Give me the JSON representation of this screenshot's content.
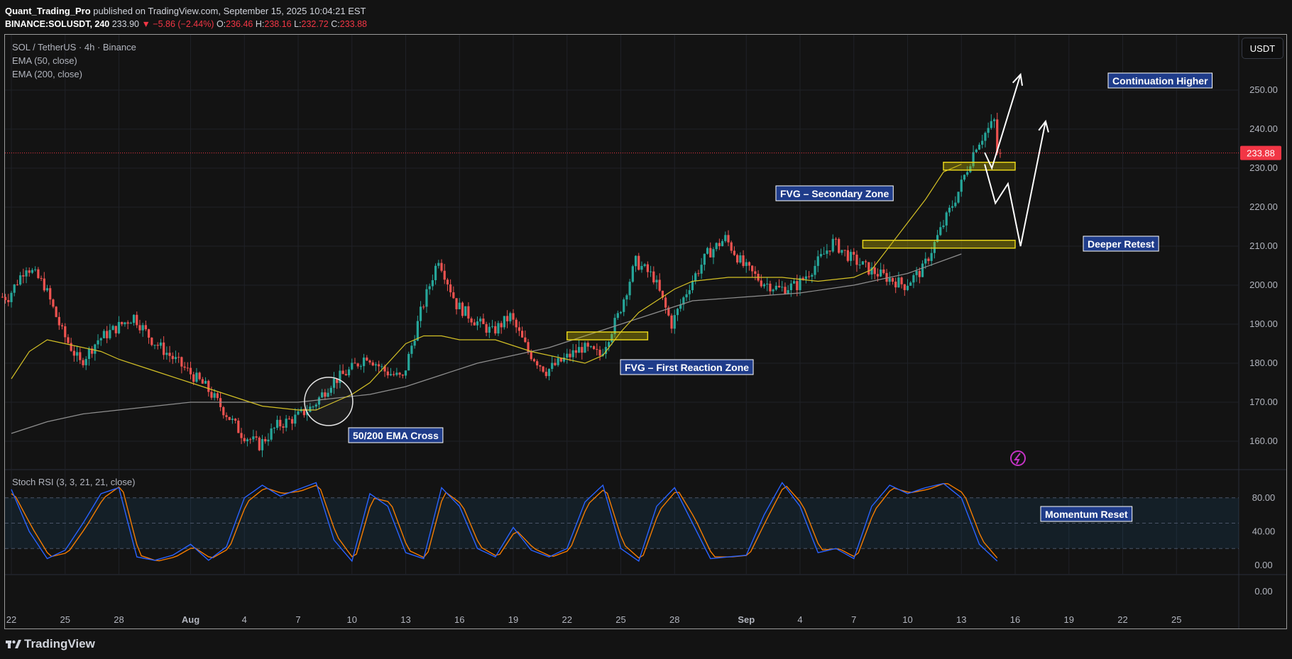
{
  "header": {
    "author": "Quant_Trading_Pro",
    "published_text": "published on TradingView.com, September 15, 2025 10:04:21 EST",
    "symbol_line": "BINANCE:SOLUSDT, 240",
    "price": "233.90",
    "change": "▼ −5.86 (−2.44%)",
    "open_label": "O:",
    "open": "236.46",
    "high_label": "H:",
    "high": "238.16",
    "low_label": "L:",
    "low": "232.72",
    "close_label": "C:",
    "close": "233.88"
  },
  "legend": {
    "title": "SOL / TetherUS · 4h · Binance",
    "ema50": "EMA (50, close)",
    "ema200": "EMA (200, close)",
    "stoch": "Stoch RSI (3, 3, 21, 21, close)"
  },
  "currency_button": "USDT",
  "last_price_tag": "233.88",
  "branding": "TradingView",
  "colors": {
    "up": "#26a69a",
    "down": "#ef5350",
    "ema50": "#d4c126",
    "ema200": "#8f8f8f",
    "stoch_k": "#2962ff",
    "stoch_d": "#f57c00",
    "zone": "#c8b800",
    "annotation": "#1f3c8a"
  },
  "chart_data": [
    {
      "type": "candlestick",
      "title": "SOL / TetherUS · 4h · Binance",
      "ylim": [
        155,
        257
      ],
      "y_ticks": [
        160,
        170,
        180,
        190,
        200,
        210,
        220,
        230,
        240,
        250
      ],
      "y_tick_labels": [
        "160.00",
        "170.00",
        "180.00",
        "190.00",
        "200.00",
        "210.00",
        "220.00",
        "230.00",
        "240.00",
        "250.00"
      ],
      "x_tick_labels": [
        "22",
        "25",
        "28",
        "Aug",
        "4",
        "7",
        "10",
        "13",
        "16",
        "19",
        "22",
        "25",
        "28",
        "Sep",
        "4",
        "7",
        "10",
        "13",
        "16",
        "19",
        "22",
        "25"
      ],
      "x_tick_days": [
        -10,
        -7,
        -4,
        0,
        3,
        6,
        9,
        12,
        15,
        18,
        21,
        24,
        27,
        31,
        34,
        37,
        40,
        43,
        46,
        49,
        52,
        55
      ],
      "x_label_note": "day index relative to Aug 1, 2025",
      "ohlc_key_closes": {
        "days": [
          -10,
          -9,
          -8,
          -7,
          -6,
          -5,
          -4,
          -3,
          -2,
          -1,
          0,
          1,
          2,
          3,
          4,
          5,
          6,
          7,
          8,
          9,
          10,
          11,
          12,
          13,
          14,
          15,
          16,
          17,
          18,
          19,
          20,
          21,
          22,
          23,
          24,
          25,
          26,
          27,
          28,
          29,
          30,
          31,
          32,
          33,
          34,
          35,
          36,
          37,
          38,
          39,
          40,
          41,
          42,
          43,
          44,
          45
        ],
        "close": [
          197,
          205,
          200,
          188,
          180,
          186,
          189,
          192,
          186,
          182,
          178,
          174,
          168,
          162,
          159,
          164,
          166,
          169,
          175,
          178,
          182,
          178,
          176,
          193,
          207,
          195,
          191,
          188,
          192,
          183,
          178,
          181,
          184,
          182,
          192,
          206,
          202,
          190,
          200,
          208,
          212,
          205,
          201,
          199,
          200,
          205,
          211,
          207,
          204,
          202,
          200,
          204,
          214,
          224,
          236,
          242,
          238,
          234
        ]
      },
      "last_price": 233.88,
      "ema50_close": [
        176,
        183,
        186,
        185,
        184,
        183,
        181,
        178,
        175,
        172,
        169,
        168,
        168,
        170,
        172,
        175,
        180,
        185,
        187,
        187,
        186,
        186,
        183,
        181,
        180,
        182,
        188,
        193,
        196,
        199,
        201,
        202,
        202,
        202,
        201,
        202,
        204,
        210,
        216,
        222,
        229,
        231
      ],
      "ema50_days": [
        -10,
        -9,
        -8,
        -7,
        -6,
        -5,
        -4,
        -2,
        0,
        2,
        4,
        6,
        7,
        8,
        9,
        10,
        11,
        12,
        13,
        14,
        15,
        17,
        19,
        21,
        22,
        23,
        24,
        25,
        26,
        27,
        28,
        30,
        31,
        33,
        35,
        37,
        38,
        39,
        40,
        41,
        42,
        43
      ],
      "ema200_close": [
        162,
        165,
        167,
        168,
        169,
        170,
        170,
        170,
        170,
        171,
        172,
        174,
        177,
        180,
        182,
        184,
        187,
        190,
        193,
        196,
        197,
        198,
        200,
        203,
        208
      ],
      "ema200_days": [
        -10,
        -8,
        -6,
        -4,
        -2,
        0,
        2,
        4,
        6,
        8,
        10,
        12,
        14,
        16,
        18,
        20,
        22,
        24,
        26,
        28,
        31,
        34,
        37,
        40,
        43
      ],
      "zones": [
        {
          "name": "FVG – First Reaction Zone",
          "day_start": 21,
          "day_end": 25.5,
          "low": 186,
          "high": 188
        },
        {
          "name": "FVG – Secondary Zone",
          "day_start": 37.5,
          "day_end": 46,
          "low": 209.5,
          "high": 211.5
        },
        {
          "name": "Upper FVG",
          "day_start": 42,
          "day_end": 46,
          "low": 229.5,
          "high": 231.5
        }
      ],
      "annotations": [
        "50/200 EMA Cross",
        "FVG – First Reaction Zone",
        "FVG – Secondary Zone",
        "Continuation Higher",
        "Deeper Retest"
      ],
      "projection_paths": [
        {
          "name": "continuation-higher",
          "points": [
            [
              44.3,
              234
            ],
            [
              44.7,
              230
            ],
            [
              46.3,
              254
            ]
          ]
        },
        {
          "name": "deeper-retest",
          "points": [
            [
              44.3,
              231
            ],
            [
              44.9,
              221
            ],
            [
              45.6,
              226
            ],
            [
              46.3,
              210
            ],
            [
              47.7,
              242
            ]
          ]
        }
      ]
    },
    {
      "type": "line",
      "title": "Stoch RSI (3, 3, 21, 21, close)",
      "ylim": [
        -10,
        105
      ],
      "y_ticks": [
        0,
        40,
        80
      ],
      "y_tick_labels": [
        "0.00",
        "40.00",
        "80.00"
      ],
      "band": [
        20,
        80
      ],
      "mid": 50,
      "extra_pane_tick": "0.00",
      "annotation": "Momentum Reset",
      "days": [
        -10,
        -9,
        -8,
        -7,
        -6,
        -5,
        -4,
        -3,
        -2,
        -1,
        0,
        1,
        2,
        3,
        4,
        5,
        6,
        7,
        8,
        9,
        10,
        11,
        12,
        13,
        14,
        15,
        16,
        17,
        18,
        19,
        20,
        21,
        22,
        23,
        24,
        25,
        26,
        27,
        28,
        29,
        30,
        31,
        32,
        33,
        34,
        35,
        36,
        37,
        38,
        39,
        40,
        41,
        42,
        43,
        44,
        45
      ],
      "series": [
        {
          "name": "K",
          "values": [
            90,
            40,
            8,
            18,
            50,
            85,
            92,
            10,
            6,
            12,
            25,
            6,
            22,
            80,
            95,
            82,
            90,
            98,
            30,
            5,
            85,
            70,
            15,
            8,
            92,
            70,
            20,
            10,
            45,
            18,
            10,
            20,
            75,
            95,
            20,
            5,
            70,
            92,
            50,
            8,
            10,
            12,
            60,
            98,
            70,
            15,
            20,
            8,
            70,
            95,
            85,
            92,
            97,
            80,
            25,
            5
          ]
        },
        {
          "name": "D",
          "values": [
            85,
            45,
            10,
            15,
            45,
            80,
            95,
            12,
            5,
            10,
            22,
            8,
            20,
            75,
            92,
            85,
            88,
            96,
            35,
            6,
            80,
            75,
            18,
            8,
            88,
            72,
            22,
            10,
            42,
            20,
            10,
            18,
            72,
            92,
            25,
            6,
            65,
            90,
            55,
            10,
            10,
            12,
            55,
            96,
            72,
            18,
            20,
            9,
            65,
            92,
            86,
            90,
            98,
            85,
            30,
            5
          ]
        }
      ]
    }
  ]
}
